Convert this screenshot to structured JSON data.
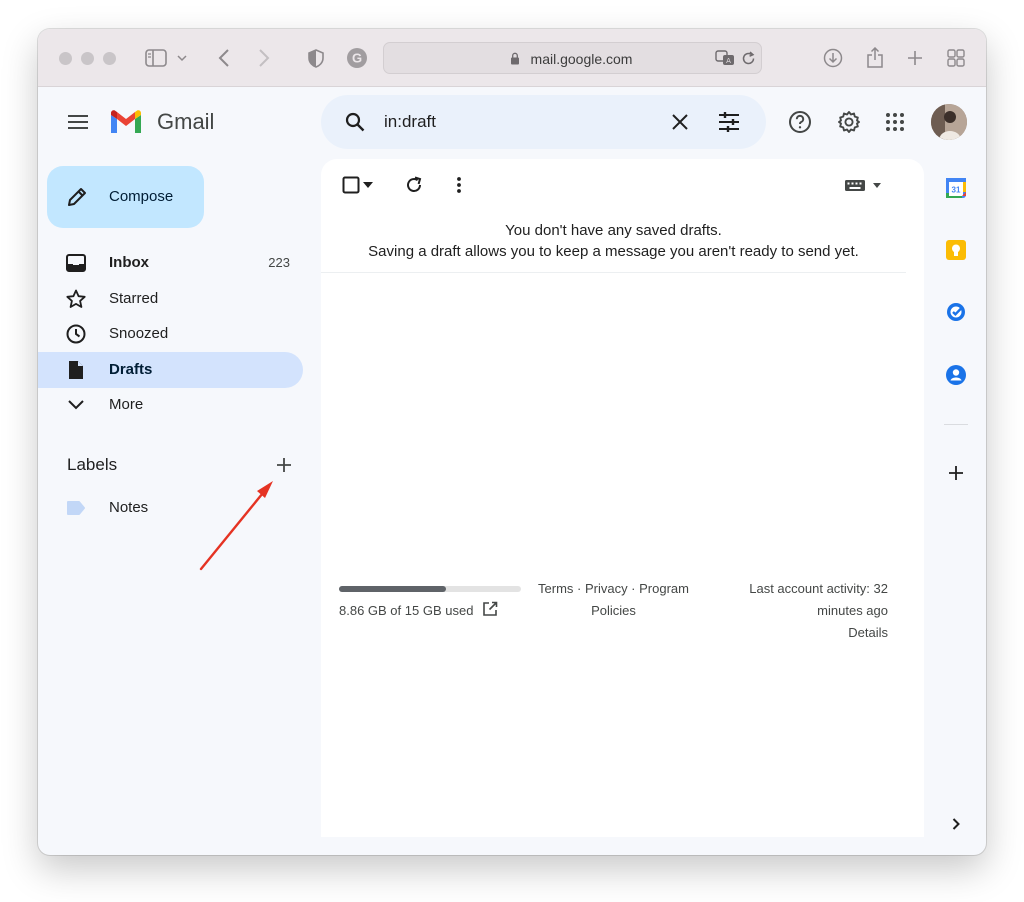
{
  "browser": {
    "url": "mail.google.com"
  },
  "app": {
    "brand": "Gmail"
  },
  "search": {
    "query": "in:draft"
  },
  "sidebar": {
    "compose_label": "Compose",
    "items": [
      {
        "label": "Inbox",
        "count": "223",
        "icon": "inbox-icon"
      },
      {
        "label": "Starred",
        "count": "",
        "icon": "star-icon"
      },
      {
        "label": "Snoozed",
        "count": "",
        "icon": "clock-icon"
      },
      {
        "label": "Drafts",
        "count": "",
        "icon": "draft-file-icon"
      },
      {
        "label": "More",
        "count": "",
        "icon": "chevron-down-icon"
      }
    ],
    "labels_heading": "Labels",
    "labels": [
      {
        "label": "Notes",
        "color": "#c2d7f7"
      }
    ]
  },
  "main": {
    "empty_title": "You don't have any saved drafts.",
    "empty_subtitle": "Saving a draft allows you to keep a message you aren't ready to send yet."
  },
  "footer": {
    "storage_text": "8.86 GB of 15 GB used",
    "storage_fraction": 0.59,
    "links_line1": "Terms · Privacy · Program",
    "links_line2": "Policies",
    "activity_line1": "Last account activity: 32",
    "activity_line2": "minutes ago",
    "details": "Details"
  },
  "right_rail": {
    "calendar_day": "31"
  },
  "colors": {
    "compose_bg": "#c2e7ff",
    "active_nav_bg": "#d3e3fd",
    "annotation_arrow": "#e53323"
  }
}
